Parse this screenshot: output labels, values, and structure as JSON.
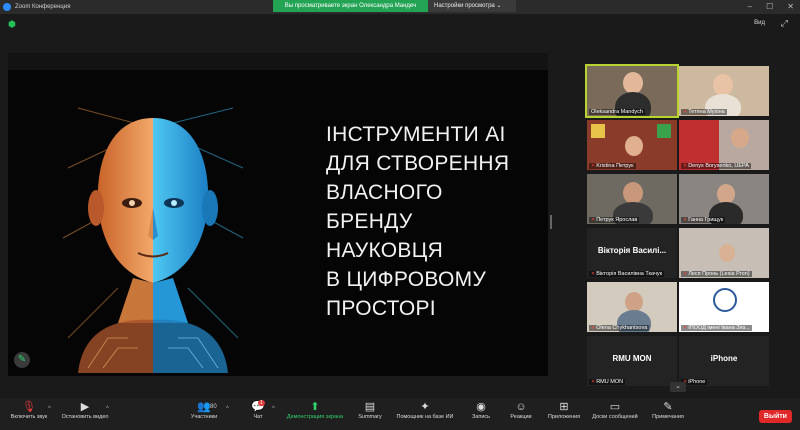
{
  "window": {
    "title": "Zoom Конференция",
    "controls": [
      "–",
      "☐",
      "✕"
    ]
  },
  "share_banner": {
    "status": "Вы просматриваете экран Олександра Мандеч",
    "options": "Настройки просмотра ⌄"
  },
  "top_right": {
    "view_label": "Вид",
    "fullscreen_icon": "⤢"
  },
  "slide": {
    "title_lines": [
      "ІНСТРУМЕНТИ AI",
      "ДЛЯ СТВОРЕННЯ",
      "ВЛАСНОГО",
      "БРЕНДУ",
      "НАУКОВЦЯ",
      "В ЦИФРОВОМУ",
      "ПРОСТОРІ"
    ]
  },
  "participants": [
    {
      "name": "Oleksandra Mandych",
      "muted": false,
      "active": true
    },
    {
      "name": "Тетяна Мухіна",
      "muted": true,
      "active": false
    },
    {
      "name": "Kristina Петрук",
      "muted": true,
      "active": false
    },
    {
      "name": "Denys Borysenko, UEPA",
      "muted": true,
      "active": false
    },
    {
      "name": "Петрук Ярослав",
      "muted": true,
      "active": false
    },
    {
      "name": "Ганна Грищук",
      "muted": true,
      "active": false
    },
    {
      "name": "Вікторія Василівна Ткачук",
      "center": "Вікторія Василі...",
      "muted": true,
      "active": false
    },
    {
      "name": "Леся Пронь (Lesia Pron)",
      "muted": true,
      "active": false
    },
    {
      "name": "Olena Chykhantsova",
      "muted": true,
      "active": false
    },
    {
      "name": "ІПООД імені Івана Зяз...",
      "muted": true,
      "active": false
    },
    {
      "name": "RMU MON",
      "center": "RMU MON",
      "muted": true,
      "active": false
    },
    {
      "name": "iPhone",
      "center": "iPhone",
      "muted": true,
      "active": false
    }
  ],
  "toolbar": {
    "unmute": "Включить звук",
    "stop_video": "Остановить видео",
    "participants": "Участники",
    "participants_count": "80",
    "chat": "Чат",
    "chat_badge": "1",
    "share": "Демонстрация экрана",
    "summary": "Summary",
    "ai_helper": "Помощник на базе ИИ",
    "record": "Запись",
    "reactions": "Реакции",
    "apps": "Приложения",
    "whiteboards": "Доски сообщений",
    "notes": "Примечания",
    "leave": "Выйти"
  },
  "colors": {
    "accent_green": "#23a455",
    "leave_red": "#e02828",
    "active_outline": "#b8d430"
  }
}
